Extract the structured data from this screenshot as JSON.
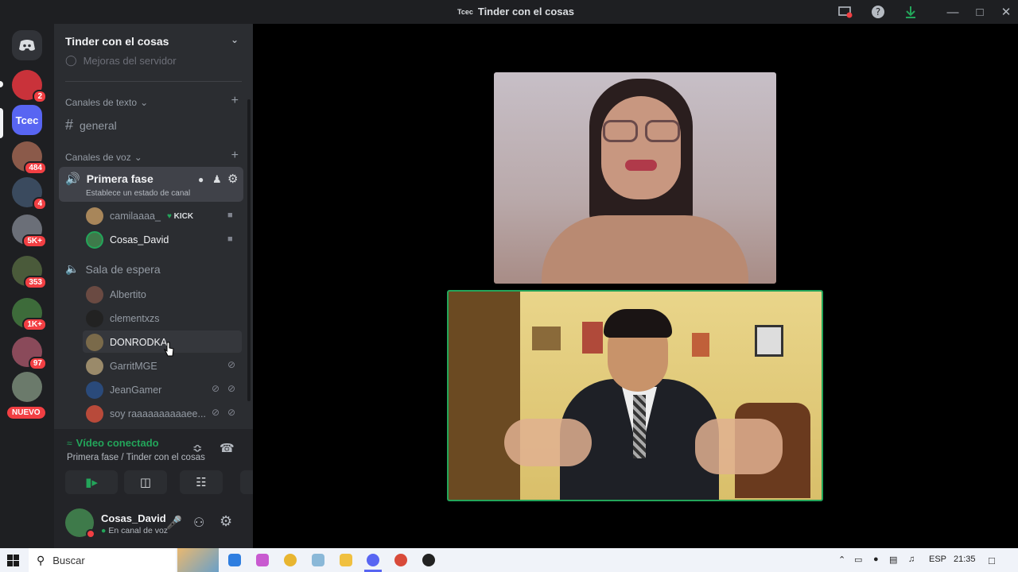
{
  "window": {
    "title": "Tinder con el cosas",
    "title_badge": "Tcec"
  },
  "guilds": {
    "badges": [
      "2",
      "484",
      "4",
      "5K+",
      "353",
      "1K+",
      "97"
    ],
    "tcec_label": "Tcec",
    "new_label": "NUEVO"
  },
  "server": {
    "name": "Tinder con el cosas",
    "cut_item": "Mejoras del servidor",
    "text_category": "Canales de texto",
    "text_channel": "general",
    "voice_category": "Canales de voz",
    "active_channel": "Primera fase",
    "active_status": "Establece un estado de canal",
    "active_users": [
      {
        "name": "camilaaaa_",
        "tag": "KICK"
      },
      {
        "name": "Cosas_David"
      }
    ],
    "waiting_channel": "Sala de espera",
    "waiting_users": [
      "Albertito",
      "clementxzs",
      "DONRODKA",
      "GarritMGE",
      "JeanGamer",
      "soy raaaaaaaaaaee..."
    ]
  },
  "voice_panel": {
    "status": "Vídeo conectado",
    "location": "Primera fase / Tinder con el cosas"
  },
  "user_panel": {
    "name": "Cosas_David",
    "status": "En canal de voz"
  },
  "taskbar": {
    "search_placeholder": "Buscar",
    "lang": "ESP",
    "time": "21:35"
  },
  "colors": {
    "accent_green": "#23a55a",
    "danger": "#f23f43",
    "sidebar_bg": "#2b2d31"
  }
}
